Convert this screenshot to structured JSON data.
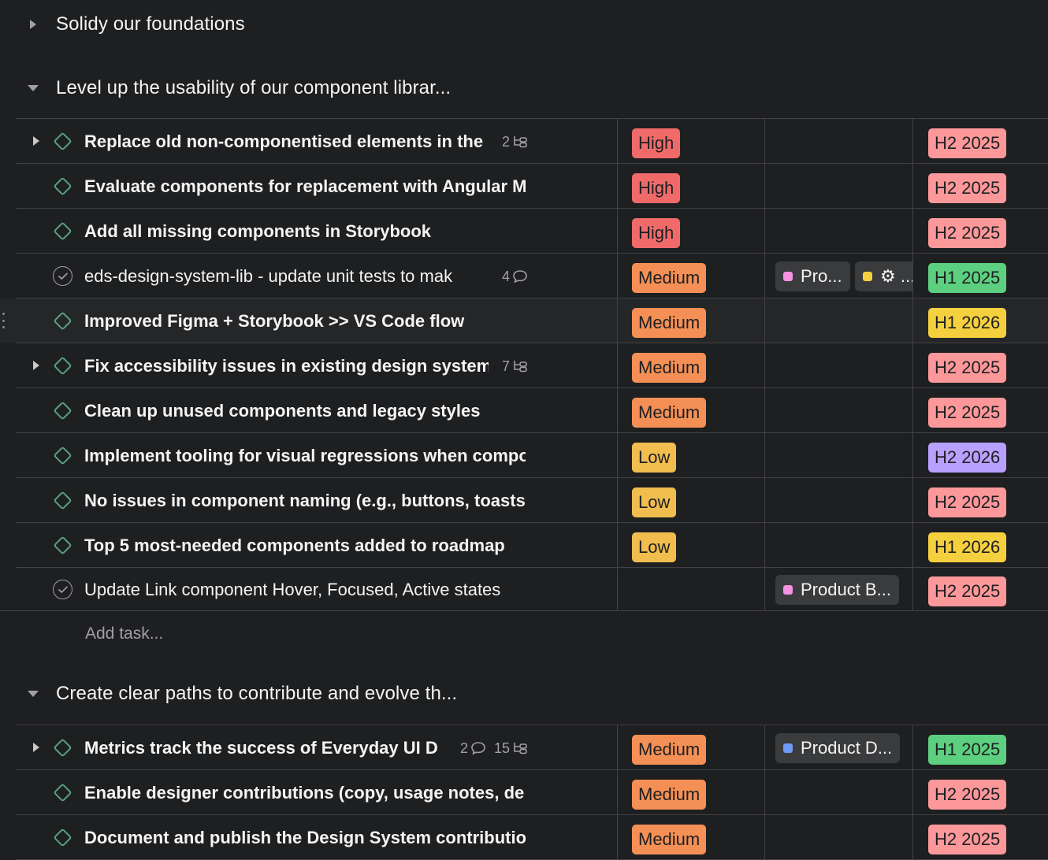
{
  "sections": [
    {
      "title": "Solidy our foundations",
      "collapsed": true
    },
    {
      "title": "Level up the usability of our component librar...",
      "collapsed": false
    },
    {
      "title": "Create clear paths to contribute and evolve th...",
      "collapsed": false
    }
  ],
  "rows": [
    {
      "name": "Replace old non-componentised elements in the",
      "status": "milestone",
      "bold": true,
      "expandable": true,
      "subtasks": "2",
      "comments": null,
      "priority": "High",
      "projects": [],
      "timeline": "H2 2025"
    },
    {
      "name": "Evaluate components for replacement with Angular M",
      "status": "milestone",
      "bold": true,
      "expandable": false,
      "subtasks": null,
      "comments": null,
      "priority": "High",
      "projects": [],
      "timeline": "H2 2025"
    },
    {
      "name": "Add all missing components in Storybook",
      "status": "milestone",
      "bold": true,
      "expandable": false,
      "subtasks": null,
      "comments": null,
      "priority": "High",
      "projects": [],
      "timeline": "H2 2025"
    },
    {
      "name": "eds-design-system-lib - update unit tests to mak",
      "status": "task",
      "bold": false,
      "expandable": false,
      "subtasks": null,
      "comments": "4",
      "priority": "Medium",
      "projects": [
        {
          "label": "Pro...",
          "color": "#f493e0"
        },
        {
          "label": "⚙ ...",
          "color": "#f4d03f"
        }
      ],
      "timeline": "H1 2025"
    },
    {
      "name": "Improved Figma + Storybook >> VS Code flow",
      "status": "milestone",
      "bold": true,
      "expandable": false,
      "subtasks": null,
      "comments": null,
      "priority": "Medium",
      "projects": [],
      "timeline": "H1 2026"
    },
    {
      "name": "Fix accessibility issues in existing design system",
      "status": "milestone",
      "bold": true,
      "expandable": true,
      "subtasks": "7",
      "comments": null,
      "priority": "Medium",
      "projects": [],
      "timeline": "H2 2025"
    },
    {
      "name": "Clean up unused components and legacy styles",
      "status": "milestone",
      "bold": true,
      "expandable": false,
      "subtasks": null,
      "comments": null,
      "priority": "Medium",
      "projects": [],
      "timeline": "H2 2025"
    },
    {
      "name": "Implement tooling for visual regressions when compo",
      "status": "milestone",
      "bold": true,
      "expandable": false,
      "subtasks": null,
      "comments": null,
      "priority": "Low",
      "projects": [],
      "timeline": "H2 2026"
    },
    {
      "name": "No issues in component naming (e.g., buttons, toasts",
      "status": "milestone",
      "bold": true,
      "expandable": false,
      "subtasks": null,
      "comments": null,
      "priority": "Low",
      "projects": [],
      "timeline": "H2 2025"
    },
    {
      "name": "Top 5 most-needed components added to roadmap",
      "status": "milestone",
      "bold": true,
      "expandable": false,
      "subtasks": null,
      "comments": null,
      "priority": "Low",
      "projects": [],
      "timeline": "H1 2026"
    },
    {
      "name": "Update Link component Hover, Focused, Active states",
      "status": "task",
      "bold": false,
      "expandable": false,
      "subtasks": null,
      "comments": null,
      "priority": null,
      "projects": [
        {
          "label": "Product B...",
          "color": "#f493e0"
        }
      ],
      "timeline": "H2 2025"
    },
    {
      "name": "Metrics track the success of Everyday UI D",
      "status": "milestone",
      "bold": true,
      "expandable": true,
      "subtasks": "15",
      "comments": "2",
      "priority": "Medium",
      "projects": [
        {
          "label": "Product D...",
          "color": "#6f9cf6"
        }
      ],
      "timeline": "H1 2025"
    },
    {
      "name": "Enable designer contributions (copy, usage notes, de",
      "status": "milestone",
      "bold": true,
      "expandable": false,
      "subtasks": null,
      "comments": null,
      "priority": "Medium",
      "projects": [],
      "timeline": "H2 2025"
    },
    {
      "name": "Document and publish the Design System contributio",
      "status": "milestone",
      "bold": true,
      "expandable": false,
      "subtasks": null,
      "comments": null,
      "priority": "Medium",
      "projects": [],
      "timeline": "H2 2025"
    }
  ],
  "add_task": {
    "label": "Add task..."
  }
}
